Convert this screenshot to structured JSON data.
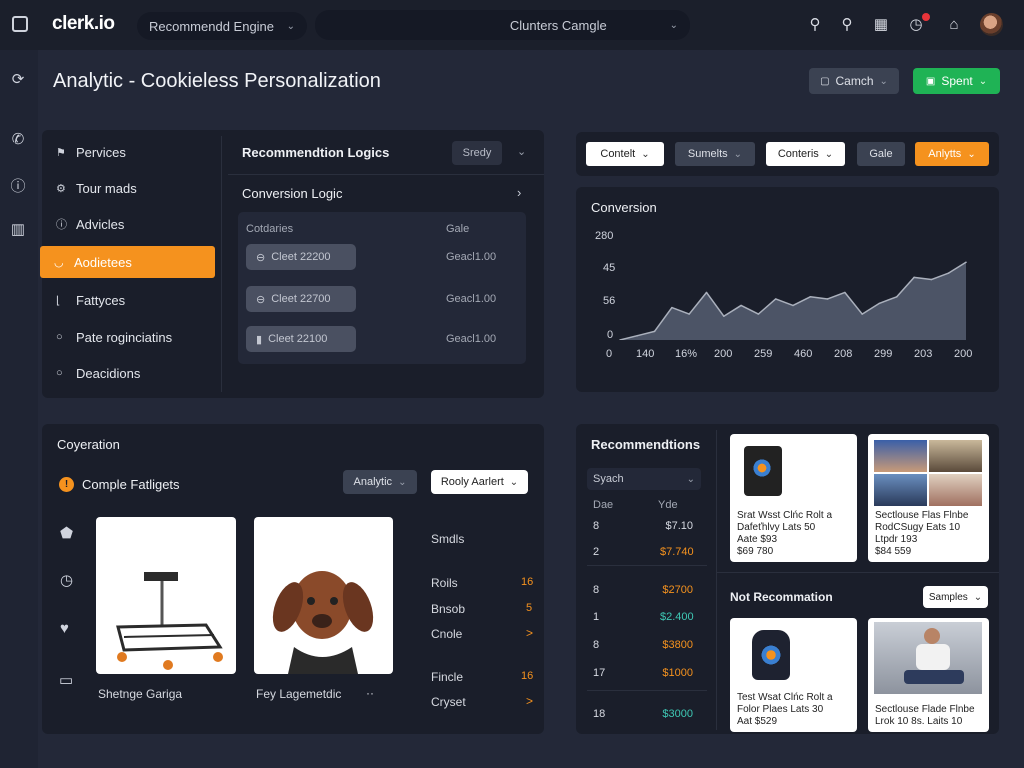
{
  "app": {
    "logo": "clerk.io"
  },
  "topbar": {
    "engine_select": "Recommendd Engine",
    "cluster_select": "Clunters Camgle"
  },
  "page": {
    "title": "Analytic - Cookieless Personalization",
    "camch_button": "Camch",
    "spent_button": "Spent"
  },
  "sidebar_menu": {
    "items": [
      {
        "label": "Pervices",
        "icon": "flag-icon"
      },
      {
        "label": "Tour mads",
        "icon": "gear-icon"
      },
      {
        "label": "Advicles",
        "icon": "info-icon"
      },
      {
        "label": "Aodietees",
        "icon": "shield-icon"
      },
      {
        "label": "Fattyces",
        "icon": "bracket-icon"
      },
      {
        "label": "Pate roginciatins",
        "icon": "circle-icon"
      },
      {
        "label": "Deacidions",
        "icon": "circle-icon"
      }
    ]
  },
  "logic": {
    "title": "Recommendtion Logics",
    "status": "Sredy",
    "subtitle": "Conversion Logic",
    "col_left": "Cotdaries",
    "col_right": "Gale",
    "rows": [
      {
        "pill": "Cleet 22200",
        "value": "Geacl1.00"
      },
      {
        "pill": "Cleet 22700",
        "value": "Geacl1.00"
      },
      {
        "pill": "Cleet 22100",
        "value": "Geacl1.00"
      }
    ]
  },
  "filters": {
    "contelt": "Contelt",
    "sumelts": "Sumelts",
    "conteris": "Conteris",
    "gale": "Gale",
    "anlytts": "Anlytts"
  },
  "conversion_chart": {
    "title": "Conversion",
    "ylabels": [
      "280",
      "45",
      "56",
      "0"
    ],
    "xlabels": [
      "0",
      "140",
      "16%",
      "200",
      "259",
      "460",
      "208",
      "299",
      "203",
      "200"
    ]
  },
  "chart_data": {
    "type": "area",
    "title": "Conversion",
    "ytick_labels": [
      "280",
      "45",
      "56",
      "0"
    ],
    "xtick_labels": [
      "0",
      "140",
      "16%",
      "200",
      "259",
      "460",
      "208",
      "299",
      "203",
      "200"
    ],
    "x": [
      0,
      1,
      2,
      3,
      4,
      5,
      6,
      7,
      8,
      9,
      10,
      11,
      12,
      13,
      14,
      15,
      16,
      17,
      18,
      19,
      20
    ],
    "values": [
      0,
      0.04,
      0.08,
      0.3,
      0.24,
      0.44,
      0.22,
      0.32,
      0.24,
      0.38,
      0.32,
      0.4,
      0.38,
      0.44,
      0.24,
      0.34,
      0.4,
      0.58,
      0.56,
      0.62,
      0.72
    ],
    "ylim": [
      0,
      1
    ],
    "grid": false,
    "colors": {
      "fill": "#4c5466",
      "line": "#aab0bc"
    }
  },
  "coyeration": {
    "title": "Coyeration",
    "subtitle": "Comple Fatligets",
    "analytic_select": "Analytic",
    "rooly_select": "Rooly Aarlert",
    "products": [
      {
        "caption": "Shetnge Gariga",
        "icon": "cart-icon"
      },
      {
        "caption": "Fey Lagemetdic",
        "icon": "dog-icon",
        "extra": "··"
      }
    ],
    "side_labels": {
      "smdls": "Smdls"
    },
    "stats": [
      {
        "label": "Roils",
        "value": "16"
      },
      {
        "label": "Bnsob",
        "value": "5"
      },
      {
        "label": "Cnole",
        "value": ">"
      },
      {
        "label": "Fincle",
        "value": "16"
      },
      {
        "label": "Cryset",
        "value": ">"
      }
    ]
  },
  "recommendations": {
    "title": "Recommendtions",
    "search_select": "Syach",
    "col_left": "Dae",
    "col_right": "Yde",
    "rows": [
      {
        "num": "8",
        "value": "$7.10",
        "color": "#d8dbe3"
      },
      {
        "num": "2",
        "value": "$7.740",
        "color": "#f5921e"
      },
      {
        "num": "8",
        "value": "$2700",
        "color": "#f5921e"
      },
      {
        "num": "1",
        "value": "$2.400",
        "color": "#3ec8b4"
      },
      {
        "num": "8",
        "value": "$3800",
        "color": "#f5921e"
      },
      {
        "num": "17",
        "value": "$1000",
        "color": "#f5921e"
      },
      {
        "num": "18",
        "value": "$3000",
        "color": "#3ec8b4"
      }
    ],
    "cards_top": [
      {
        "text": [
          "Srat Wsst Clńc Rolt a",
          "Dafeťhlvy Lats 50",
          "Aate $93",
          "$69 780"
        ]
      },
      {
        "text": [
          "Sectlouse Flas Flnbe",
          "RodCSugy Eats 10",
          "Ltpdr 193",
          "$84 559"
        ]
      }
    ],
    "not_rec_title": "Not Recommation",
    "samples_select": "Samples",
    "cards_bottom": [
      {
        "text": [
          "Test Wsat Clńc Rolt a",
          "Folor Plaes Lats 30",
          "Aat $529"
        ]
      },
      {
        "text": [
          "Sectlouse Flade Flnbe",
          "Lrok 10 8s. Laits 10"
        ]
      }
    ]
  },
  "colors": {
    "accent": "#f5921e",
    "green": "#1fb355",
    "panel": "#1a1e2a",
    "bg": "#232838"
  }
}
